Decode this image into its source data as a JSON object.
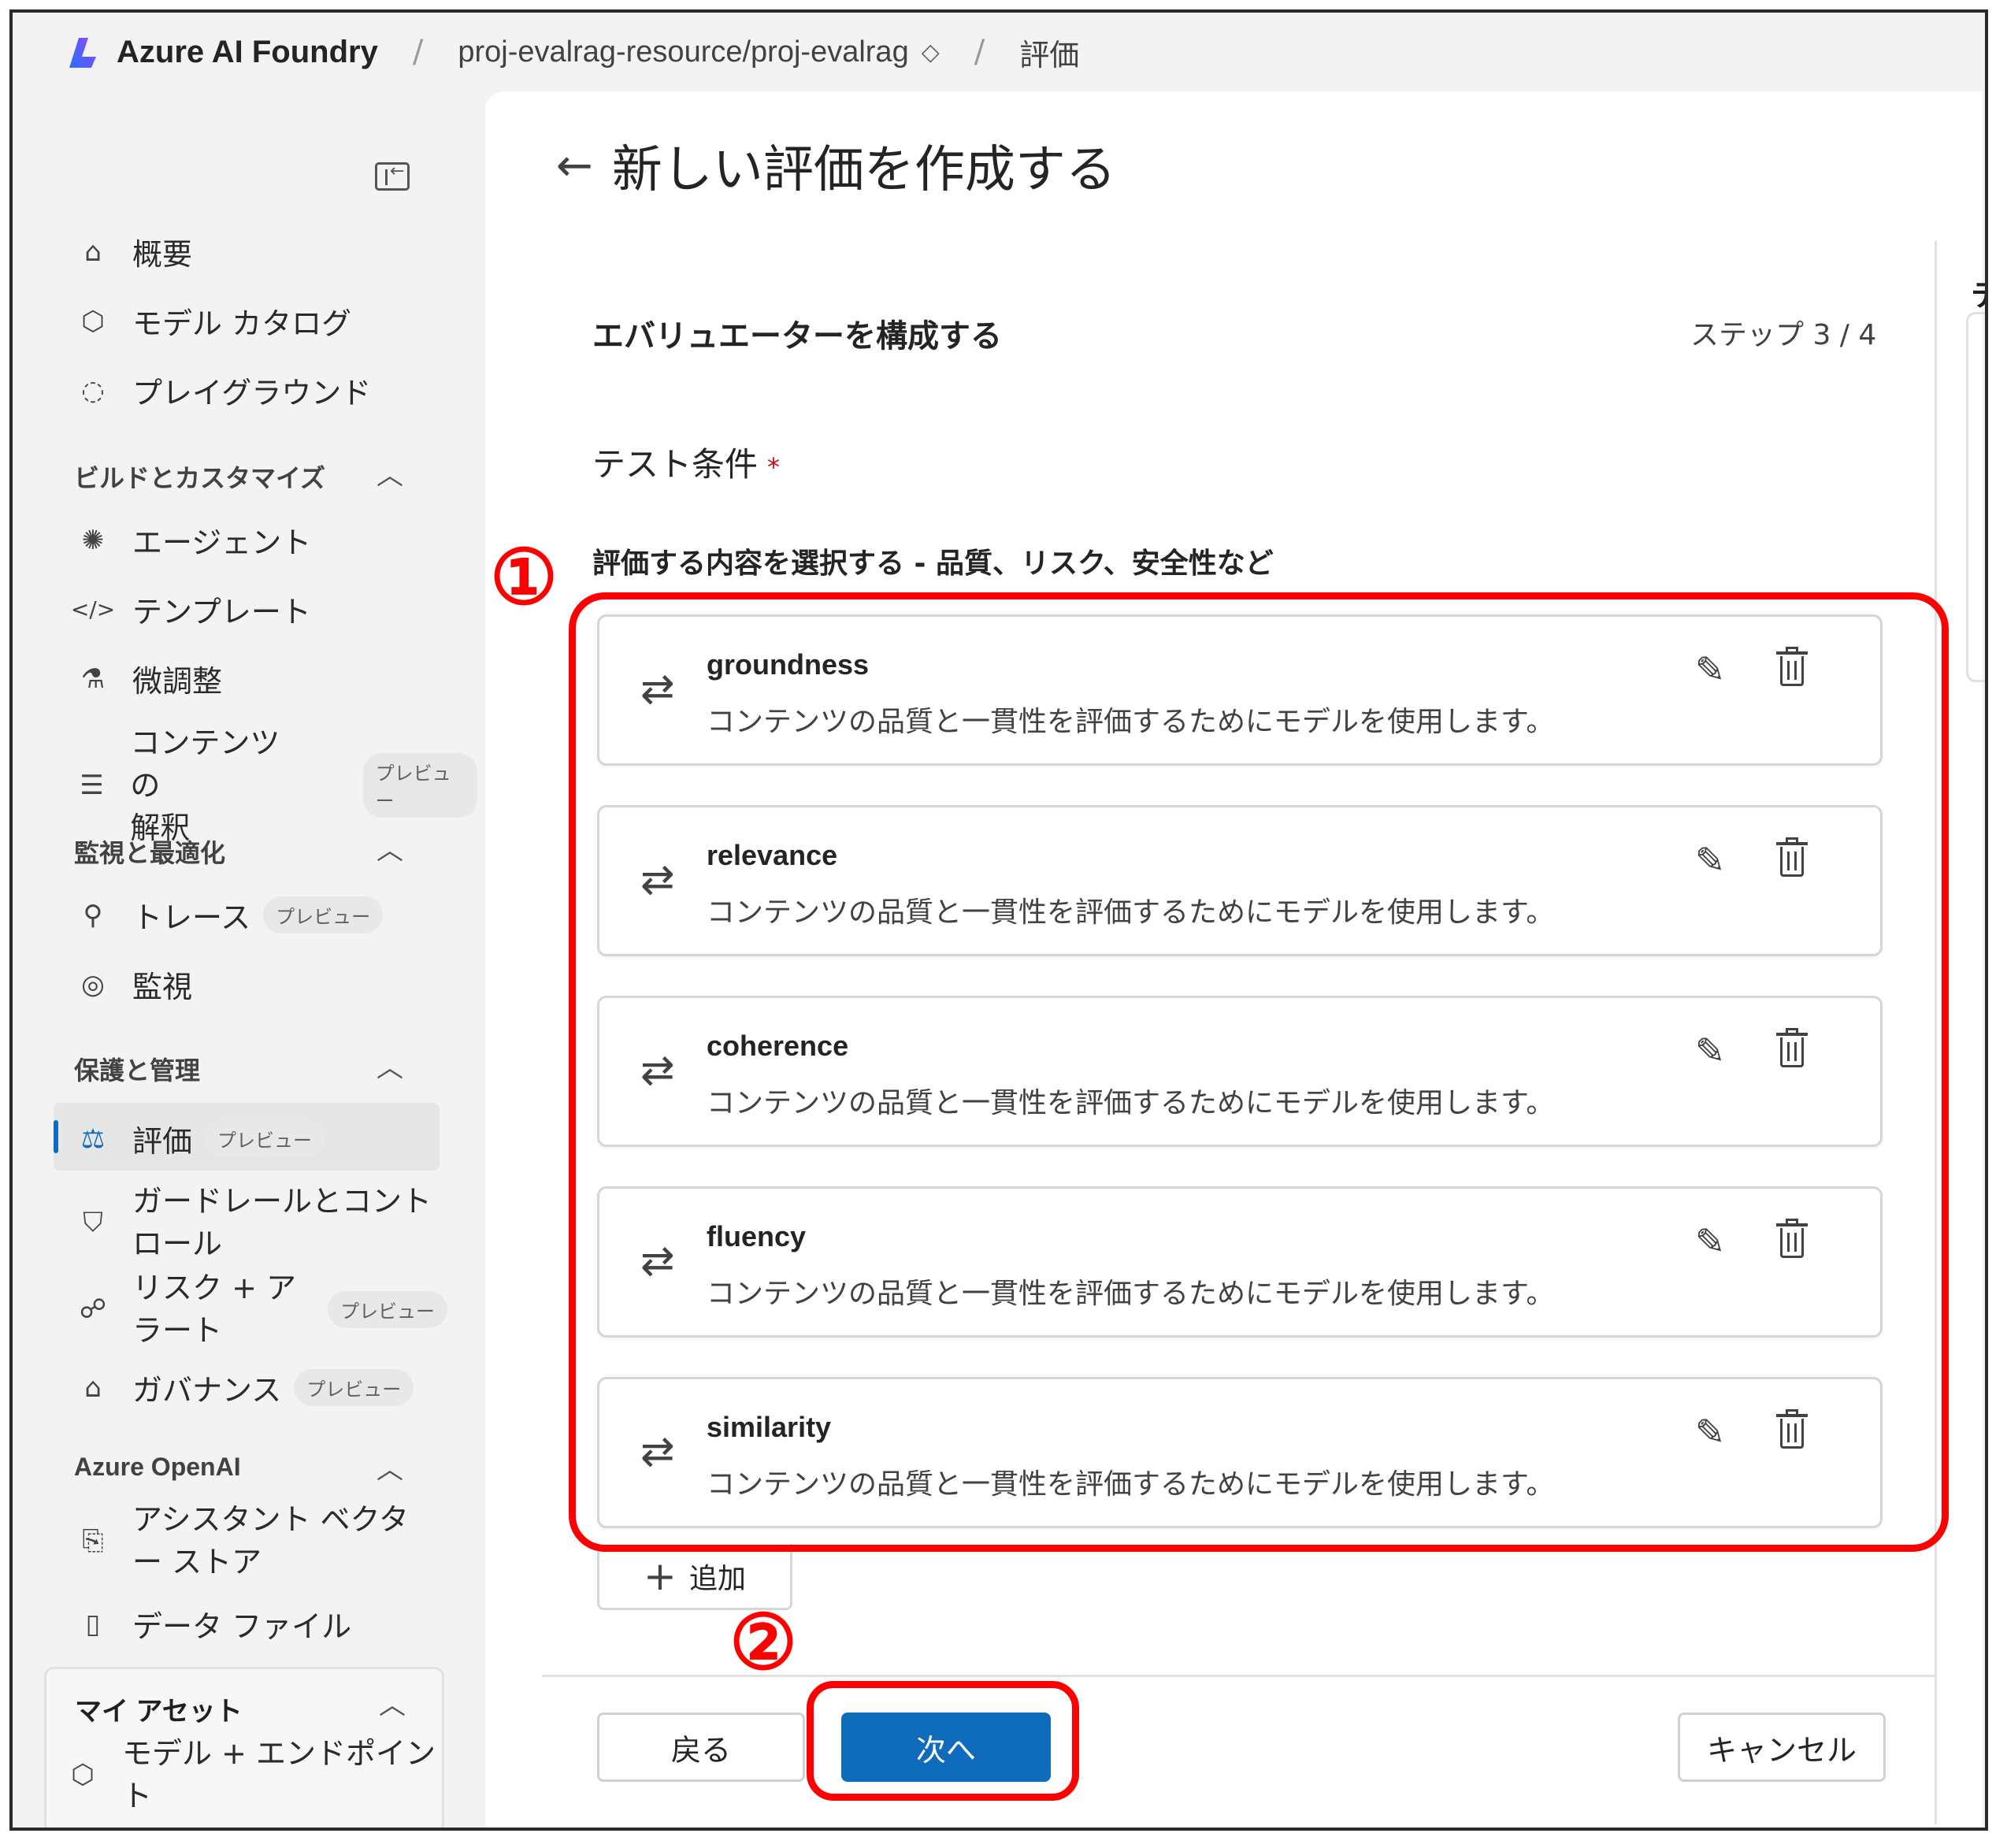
{
  "topbar": {
    "brand": "Azure AI Foundry",
    "separator": "/",
    "project": "proj-evalrag-resource/proj-evalrag",
    "project_chevron": "◇",
    "current": "評価"
  },
  "sidebar": {
    "items": [
      {
        "label": "概要",
        "icon": "home-icon"
      },
      {
        "label": "モデル カタログ",
        "icon": "cube-icon"
      },
      {
        "label": "プレイグラウンド",
        "icon": "chat-icon"
      },
      {
        "label": "エージェント",
        "icon": "agent-icon"
      },
      {
        "label": "テンプレート",
        "icon": "code-icon"
      },
      {
        "label": "微調整",
        "icon": "flask-icon"
      },
      {
        "label_line1": "コンテンツの",
        "label_line2": "解釈",
        "badge": "プレビュー",
        "icon": "doc-icon"
      },
      {
        "label": "トレース",
        "badge": "プレビュー",
        "icon": "trace-icon"
      },
      {
        "label": "監視",
        "icon": "camera-icon"
      },
      {
        "label": "評価",
        "badge": "プレビュー",
        "icon": "scale-icon"
      },
      {
        "label_line1": "ガードレールとコント",
        "label_line2": "ロール",
        "icon": "shield-icon"
      },
      {
        "label_line1": "リスク + ア",
        "label_line2": "ラート",
        "badge": "プレビュー",
        "icon": "alert-icon"
      },
      {
        "label": "ガバナンス",
        "badge": "プレビュー",
        "icon": "bank-icon"
      },
      {
        "label_line1": "アシスタント ベクタ",
        "label_line2": "ー ストア",
        "icon": "vector-icon"
      },
      {
        "label": "データ ファイル",
        "icon": "file-icon"
      },
      {
        "label_line1": "モデル + エンドポイン",
        "label_line2": "ト",
        "icon": "box-icon"
      }
    ],
    "sections": {
      "build": "ビルドとカスタマイズ",
      "monitor": "監視と最適化",
      "protect": "保護と管理",
      "openai": "Azure OpenAI",
      "assets": "マイ アセット"
    }
  },
  "main": {
    "title": "新しい評価を作成する",
    "step_title": "エバリュエーターを構成する",
    "step_count": "ステップ 3 / 4",
    "test_label": "テスト条件",
    "required_mark": "*",
    "select_label": "評価する内容を選択する - 品質、リスク、安全性など",
    "evaluators": [
      {
        "name": "groundness",
        "desc": "コンテンツの品質と一貫性を評価するためにモデルを使用します。"
      },
      {
        "name": "relevance",
        "desc": "コンテンツの品質と一貫性を評価するためにモデルを使用します。"
      },
      {
        "name": "coherence",
        "desc": "コンテンツの品質と一貫性を評価するためにモデルを使用します。"
      },
      {
        "name": "fluency",
        "desc": "コンテンツの品質と一貫性を評価するためにモデルを使用します。"
      },
      {
        "name": "similarity",
        "desc": "コンテンツの品質と一貫性を評価するためにモデルを使用します。"
      }
    ],
    "add_label": "追加",
    "back_label": "戻る",
    "next_label": "次へ",
    "cancel_label": "キャンセル",
    "right_peek": "テ"
  },
  "annotations": {
    "one": "①",
    "two": "②"
  },
  "colors": {
    "accent": "#0f6cbd",
    "annotation": "#ff0000"
  }
}
